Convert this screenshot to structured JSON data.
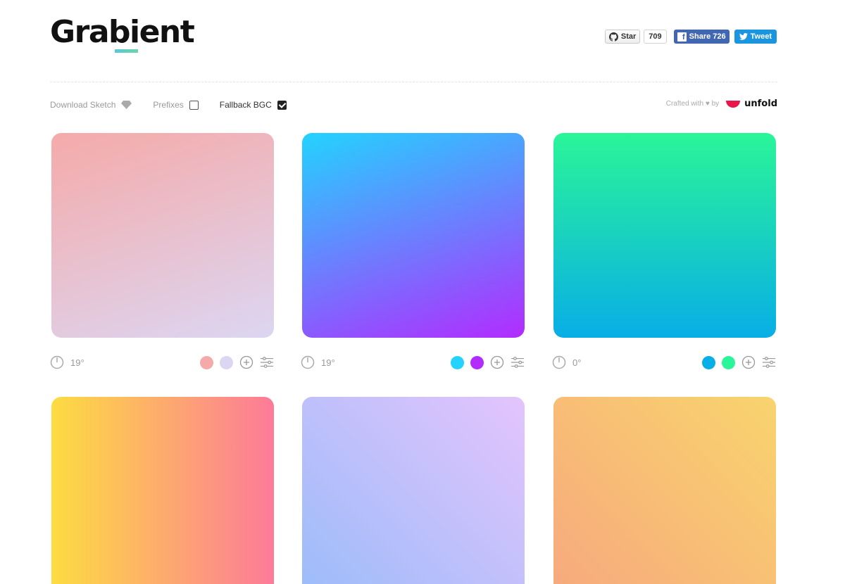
{
  "header": {
    "logo_text": "Grabient"
  },
  "social": {
    "github_star_label": "Star",
    "github_star_count": "709",
    "facebook_share_label": "Share 726",
    "tweet_label": "Tweet"
  },
  "toolbar": {
    "download_sketch_label": "Download Sketch",
    "prefixes_label": "Prefixes",
    "prefixes_checked": false,
    "fallback_label": "Fallback BGC",
    "fallback_checked": true
  },
  "credit": {
    "crafted_label": "Crafted with ♥ by",
    "brand": "unfold"
  },
  "gradients": [
    {
      "angle": "19°",
      "stops": [
        "#f5aaa9",
        "#dcd6f2"
      ]
    },
    {
      "angle": "19°",
      "stops": [
        "#23d3fe",
        "#b22cfe"
      ]
    },
    {
      "angle": "0°",
      "stops": [
        "#08aee6",
        "#2af598"
      ]
    },
    {
      "angle": "90°",
      "stops": [
        "#fddc41",
        "#fd7a99"
      ]
    },
    {
      "angle": "45°",
      "stops": [
        "#9abcfa",
        "#e4c4fc"
      ]
    },
    {
      "angle": "45°",
      "stops": [
        "#f7a87e",
        "#f8d46d"
      ]
    }
  ],
  "colors": {
    "github_button": "#eeeeee",
    "facebook": "#4267b2",
    "twitter": "#1b95e0",
    "unfold_brand": "#e8174a"
  }
}
